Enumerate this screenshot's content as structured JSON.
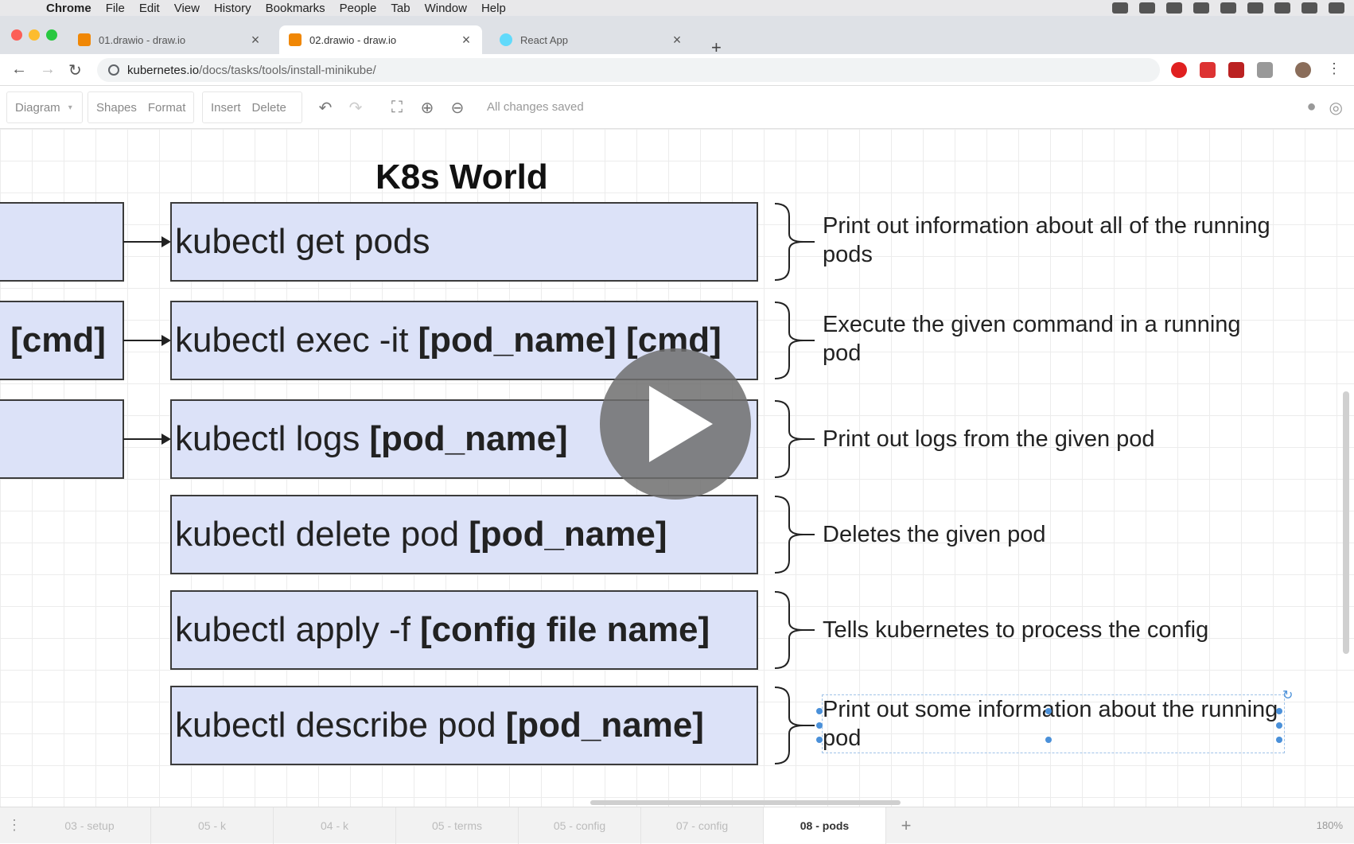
{
  "os_menu": {
    "apple": "",
    "items": [
      "Chrome",
      "File",
      "Edit",
      "View",
      "History",
      "Bookmarks",
      "People",
      "Tab",
      "Window",
      "Help"
    ]
  },
  "browser": {
    "tabs": [
      {
        "title": "01.drawio - draw.io",
        "icon": "drawio-icon",
        "active": false
      },
      {
        "title": "02.drawio - draw.io",
        "icon": "drawio-icon",
        "active": true
      },
      {
        "title": "React App",
        "icon": "react-icon",
        "active": false
      }
    ],
    "close_glyph": "×",
    "new_tab_glyph": "+",
    "url_host": "kubernetes.io",
    "url_path": "/docs/tasks/tools/install-minikube/"
  },
  "toolbar": {
    "diagram": "Diagram",
    "shapes": "Shapes",
    "format": "Format",
    "insert": "Insert",
    "delete": "Delete",
    "status": "All changes saved"
  },
  "diagram": {
    "title": "K8s World",
    "left_label": "[cmd]",
    "commands": [
      {
        "prefix": "kubectl get pods",
        "bold": "",
        "description": "Print out information about all of the running pods"
      },
      {
        "prefix": "kubectl exec -it",
        "bold": "[pod_name] [cmd]",
        "description": "Execute the given command in a running pod"
      },
      {
        "prefix": "kubectl logs",
        "bold": "[pod_name]",
        "description": "Print out logs from the given pod"
      },
      {
        "prefix": "kubectl delete pod",
        "bold": "[pod_name]",
        "description": "Deletes the given pod"
      },
      {
        "prefix": "kubectl apply -f",
        "bold": "[config file name]",
        "description": "Tells kubernetes to process the config"
      },
      {
        "prefix": "kubectl describe pod",
        "bold": "[pod_name]",
        "description": "Print out some information about the running pod"
      }
    ]
  },
  "page_tabs": {
    "items": [
      "03 - setup",
      "05 - k",
      "04 - k",
      "05 - terms",
      "05 - config",
      "07 - config",
      "08 - pods"
    ],
    "active_index": 6,
    "add_glyph": "+",
    "zoom": "180%"
  },
  "colors": {
    "box_fill": "#dce2f8",
    "box_stroke": "#3b3b3b",
    "selection_handle": "#4a90d9"
  }
}
